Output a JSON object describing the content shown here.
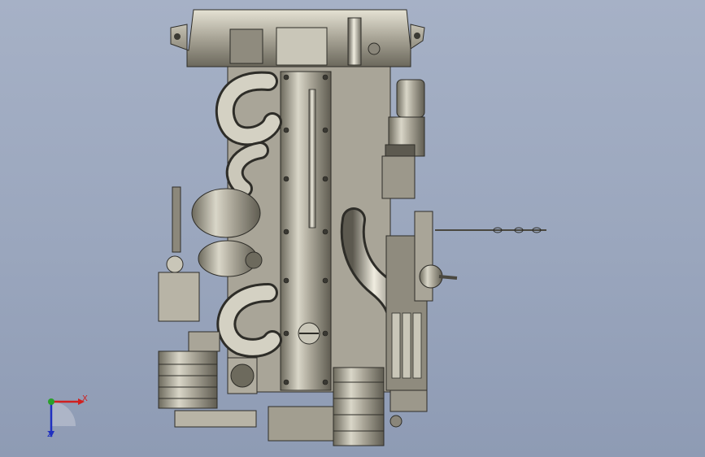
{
  "viewport": {
    "background_top": "#a6b1c6",
    "background_bottom": "#8e9bb4",
    "model_subject": "engine-assembly-top-view"
  },
  "triad": {
    "x_label": "X",
    "z_label": "Z",
    "x_color": "#d02020",
    "y_color": "#2aa02a",
    "z_color": "#2030c0"
  }
}
